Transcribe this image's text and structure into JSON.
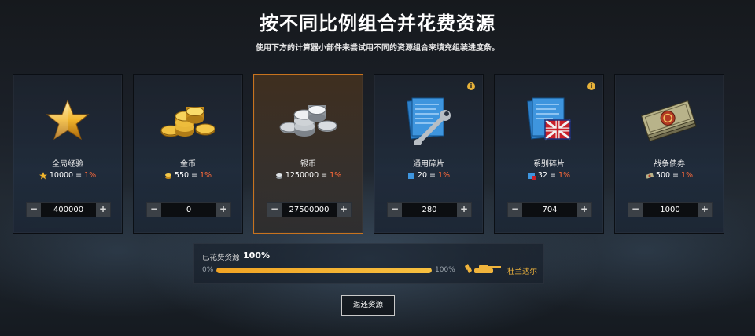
{
  "header": {
    "title": "按不同比例组合并花费资源",
    "subtitle": "使用下方的计算器小部件来尝试用不同的资源组合来填充组装进度条。"
  },
  "cards": [
    {
      "name": "全局经验",
      "rate_amount": "10000",
      "rate_eq": "=",
      "rate_pct": "1%",
      "value": "400000",
      "icon": "star-icon",
      "info": false,
      "selected": false
    },
    {
      "name": "金币",
      "rate_amount": "550",
      "rate_eq": "=",
      "rate_pct": "1%",
      "value": "0",
      "icon": "gold-coins-icon",
      "info": false,
      "selected": false
    },
    {
      "name": "银币",
      "rate_amount": "1250000",
      "rate_eq": "=",
      "rate_pct": "1%",
      "value": "27500000",
      "icon": "silver-coins-icon",
      "info": false,
      "selected": true
    },
    {
      "name": "通用碎片",
      "rate_amount": "20",
      "rate_eq": "=",
      "rate_pct": "1%",
      "value": "280",
      "icon": "universal-parts-icon",
      "info": true,
      "selected": false
    },
    {
      "name": "系别碎片",
      "rate_amount": "32",
      "rate_eq": "=",
      "rate_pct": "1%",
      "value": "704",
      "icon": "nation-parts-icon",
      "info": true,
      "selected": false
    },
    {
      "name": "战争债券",
      "rate_amount": "500",
      "rate_eq": "=",
      "rate_pct": "1%",
      "value": "1000",
      "icon": "bonds-icon",
      "info": false,
      "selected": false
    }
  ],
  "stepper": {
    "minus": "−",
    "plus": "+"
  },
  "info_glyph": "i",
  "progress": {
    "label": "已花费资源",
    "value_text": "100%",
    "fraction": 1.0,
    "min_label": "0%",
    "max_label": "100%",
    "tank_name": "杜兰达尔"
  },
  "actions": {
    "return_label": "返还资源"
  },
  "colors": {
    "accent": "#f1a424",
    "selected_border": "#c8731e",
    "percent": "#ff6a3a",
    "tank_name": "#f0b43c"
  }
}
